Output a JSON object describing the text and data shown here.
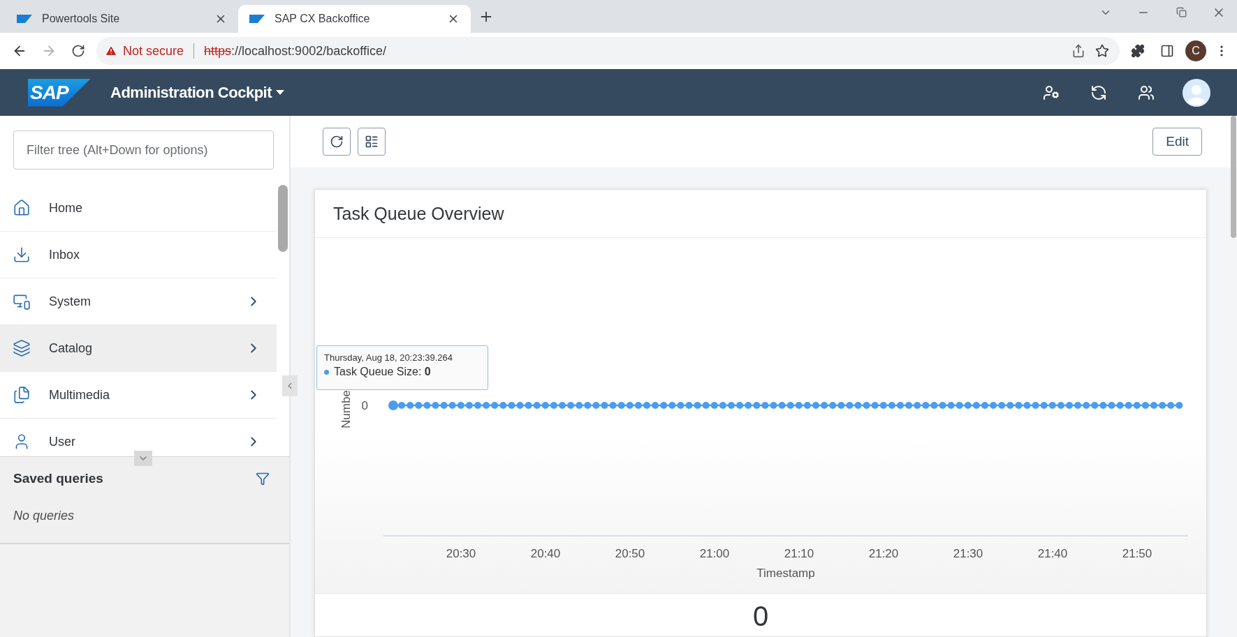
{
  "browser": {
    "tabs": [
      {
        "title": "Powertools Site",
        "selected": false
      },
      {
        "title": "SAP CX Backoffice",
        "selected": true
      }
    ],
    "security_warning": "Not secure",
    "url_scheme": "https",
    "url_rest": "://localhost:9002/backoffice/",
    "profile_initial": "C"
  },
  "app": {
    "logo": "SAP",
    "title": "Administration Cockpit"
  },
  "sidebar": {
    "filter": {
      "placeholder": "Filter tree (Alt+Down for options)"
    },
    "items": [
      {
        "label": "Home",
        "has_children": false,
        "hovered": false
      },
      {
        "label": "Inbox",
        "has_children": false,
        "hovered": false
      },
      {
        "label": "System",
        "has_children": true,
        "hovered": false
      },
      {
        "label": "Catalog",
        "has_children": true,
        "hovered": true
      },
      {
        "label": "Multimedia",
        "has_children": true,
        "hovered": false
      },
      {
        "label": "User",
        "has_children": true,
        "hovered": false
      }
    ],
    "saved_queries": {
      "title": "Saved queries",
      "empty_text": "No queries"
    }
  },
  "toolbar": {
    "edit_button": "Edit"
  },
  "widget": {
    "title": "Task Queue Overview",
    "tooltip": {
      "time": "Thursday, Aug 18, 20:23:39.264",
      "series_suffix": ": **0**"
    },
    "chart": {
      "xlabel": "Timestamp",
      "ylabel": "Numbe",
      "y_label": "0",
      "series_name": "Task Queue Size",
      "x_labels": [
        "20:30",
        "20:40",
        "20:50",
        "21:00",
        "21:10",
        "21:20",
        "21:30",
        "21:40",
        "21:50"
      ]
    },
    "total": "0"
  }
}
